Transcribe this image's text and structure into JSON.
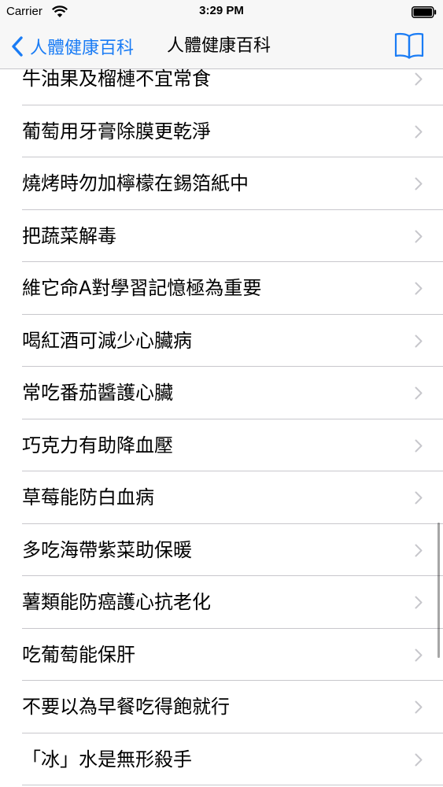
{
  "status_bar": {
    "carrier": "Carrier",
    "time": "3:29 PM"
  },
  "nav": {
    "back_label": "人體健康百科",
    "title": "人體健康百科",
    "accent_color": "#1a7cf5"
  },
  "list": {
    "items": [
      "牛油果及榴槤不宜常食",
      "葡萄用牙膏除膜更乾淨",
      "燒烤時勿加檸檬在錫箔紙中",
      "把蔬菜解毒",
      "維它命A對學習記憶極為重要",
      "喝紅酒可減少心臟病",
      "常吃番茄醬護心臟",
      "巧克力有助降血壓",
      "草莓能防白血病",
      "多吃海帶紫菜助保暖",
      "薯類能防癌護心抗老化",
      "吃葡萄能保肝",
      "不要以為早餐吃得飽就行",
      "「冰」水是無形殺手"
    ]
  }
}
